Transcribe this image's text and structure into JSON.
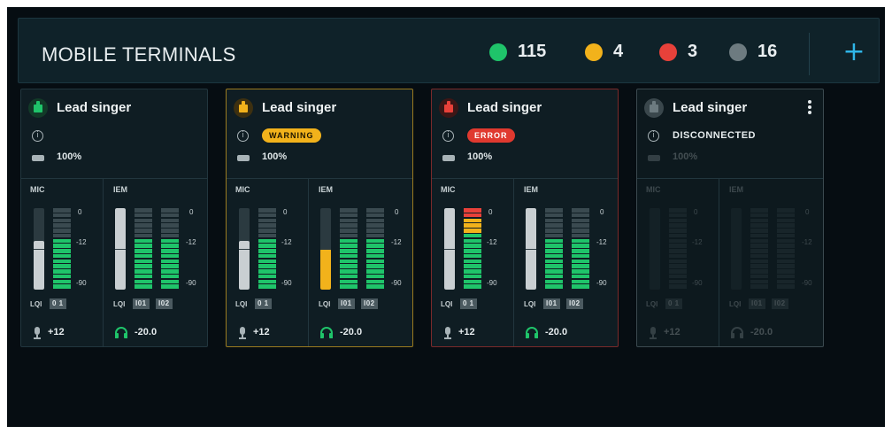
{
  "header": {
    "title": "MOBILE TERMINALS",
    "statuses": [
      {
        "name": "ok",
        "count": "115",
        "color": "#1fc46a"
      },
      {
        "name": "warning",
        "count": "4",
        "color": "#f2b21b"
      },
      {
        "name": "error",
        "count": "3",
        "color": "#e8413a"
      },
      {
        "name": "disconnected",
        "count": "16",
        "color": "#6d7b80"
      }
    ],
    "add_label": "+"
  },
  "labels": {
    "mic": "MIC",
    "iem": "IEM",
    "lqi": "LQI",
    "scale_top": "0",
    "scale_mid": "-12",
    "scale_low": "-90"
  },
  "colors": {
    "green": "#1fc46a",
    "orange": "#f2b21b",
    "red": "#e8413a",
    "grey": "#6d7b80",
    "fader": "#c9cfd2"
  },
  "cards": [
    {
      "name": "Lead singer",
      "state": "ok",
      "status_text": "",
      "battery": "100%",
      "mic_chip": "0 1",
      "iem_chips": [
        "I01",
        "I02"
      ],
      "mic_gain": "+12",
      "iem_level": "-20.0",
      "mic_level": 0.6,
      "iem_fader_fill": 1.0,
      "iem_levels": [
        0.6,
        0.6
      ],
      "icon_color": "#1fc46a"
    },
    {
      "name": "Lead singer",
      "state": "warning",
      "status_text": "WARNING",
      "battery": "100%",
      "mic_chip": "0 1",
      "iem_chips": [
        "I01",
        "I02"
      ],
      "mic_gain": "+12",
      "iem_level": "-20.0",
      "mic_level": 0.6,
      "iem_fader_fill": 0.5,
      "iem_levels": [
        0.6,
        0.6
      ],
      "icon_color": "#f2b21b"
    },
    {
      "name": "Lead singer",
      "state": "error",
      "status_text": "ERROR",
      "battery": "100%",
      "mic_chip": "0 1",
      "iem_chips": [
        "I01",
        "I02"
      ],
      "mic_gain": "+12",
      "iem_level": "-20.0",
      "mic_level": 1.0,
      "iem_fader_fill": 1.0,
      "iem_levels": [
        0.6,
        0.6
      ],
      "icon_color": "#e8413a"
    },
    {
      "name": "Lead singer",
      "state": "disconnected",
      "status_text": "DISCONNECTED",
      "battery": "100%",
      "mic_chip": "0 1",
      "iem_chips": [
        "I01",
        "I02"
      ],
      "mic_gain": "+12",
      "iem_level": "-20.0",
      "mic_level": 0,
      "iem_fader_fill": 0,
      "iem_levels": [
        0,
        0
      ],
      "icon_color": "#6d7b80"
    }
  ]
}
